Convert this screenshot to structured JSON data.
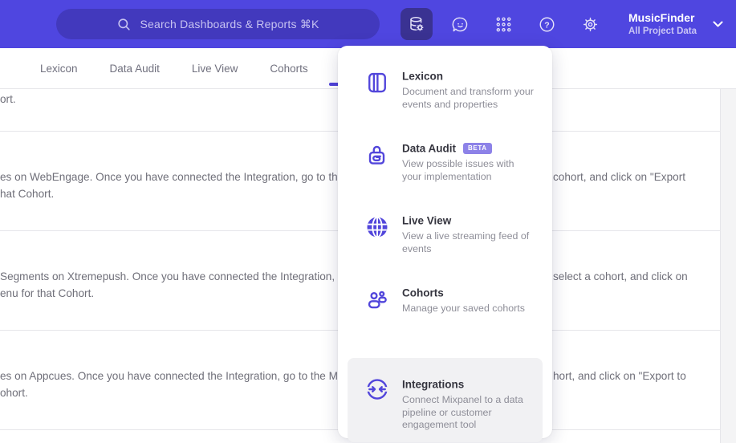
{
  "header": {
    "search_label": "Search Dashboards & Reports ⌘K",
    "project_name": "MusicFinder",
    "project_subtitle": "All Project Data",
    "colors": {
      "bar": "#4f46e0",
      "search_pill": "#4239bd",
      "active_icon_bg": "#3a3292"
    }
  },
  "tabs": [
    {
      "label": "Lexicon"
    },
    {
      "label": "Data Audit"
    },
    {
      "label": "Live View"
    },
    {
      "label": "Cohorts"
    }
  ],
  "rows": [
    {
      "left1": "ort.",
      "right1": "",
      "left2": ""
    },
    {
      "left1": "es on WebEngage. Once you have connected the Integration, go to the",
      "right1": "cohort, and click on \"Export",
      "left2": "hat Cohort."
    },
    {
      "left1": "Segments on Xtremepush. Once you have connected the Integration,",
      "right1": "select a cohort, and click on",
      "left2": "enu for that Cohort."
    },
    {
      "left1": "es on Appcues. Once you have connected the Integration, go to the M",
      "right1": "hort, and click on \"Export to",
      "left2": "ohort."
    }
  ],
  "menu": {
    "items": [
      {
        "title": "Lexicon",
        "desc": "Document and transform your events and properties",
        "icon": "book-icon"
      },
      {
        "title": "Data Audit",
        "badge": "BETA",
        "desc": "View possible issues with your implementation",
        "icon": "lock-spiral-icon"
      },
      {
        "title": "Live View",
        "desc": "View a live streaming feed of events",
        "icon": "globe-icon"
      },
      {
        "title": "Cohorts",
        "desc": "Manage your saved cohorts",
        "icon": "people-icon"
      },
      {
        "title": "Integrations",
        "desc": "Connect Mixpanel to a data pipeline or customer engagement tool",
        "icon": "sync-icon",
        "highlighted": true
      }
    ],
    "accent": "#5246db",
    "highlight_bg": "#f1f1f3",
    "badge_bg": "#8d82e8"
  }
}
